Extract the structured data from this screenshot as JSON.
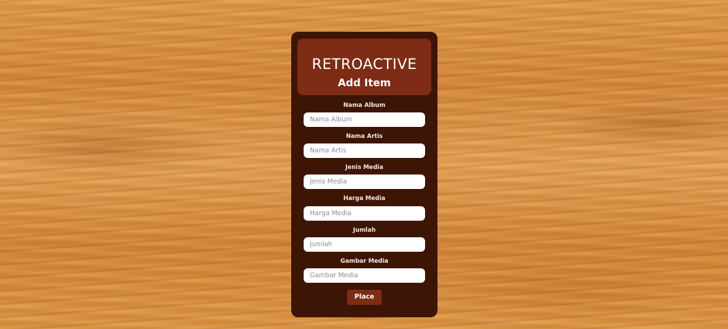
{
  "header": {
    "brand": "RETROACTIVE",
    "title": "Add Item"
  },
  "form": {
    "fields": [
      {
        "label": "Nama Album",
        "placeholder": "Nama Album",
        "value": ""
      },
      {
        "label": "Nama Artis",
        "placeholder": "Nama Artis",
        "value": ""
      },
      {
        "label": "Jenis Media",
        "placeholder": "Jenis Media",
        "value": ""
      },
      {
        "label": "Harga Media",
        "placeholder": "Harga Media",
        "value": ""
      },
      {
        "label": "Jumlah",
        "placeholder": "Jumlah",
        "value": ""
      },
      {
        "label": "Gambar Media",
        "placeholder": "Gambar Media",
        "value": ""
      }
    ],
    "submit_label": "Place"
  },
  "colors": {
    "card_background": "#3d1505",
    "accent": "#7e2c15",
    "input_background": "#ffffff",
    "page_background": "#d98f3f"
  }
}
